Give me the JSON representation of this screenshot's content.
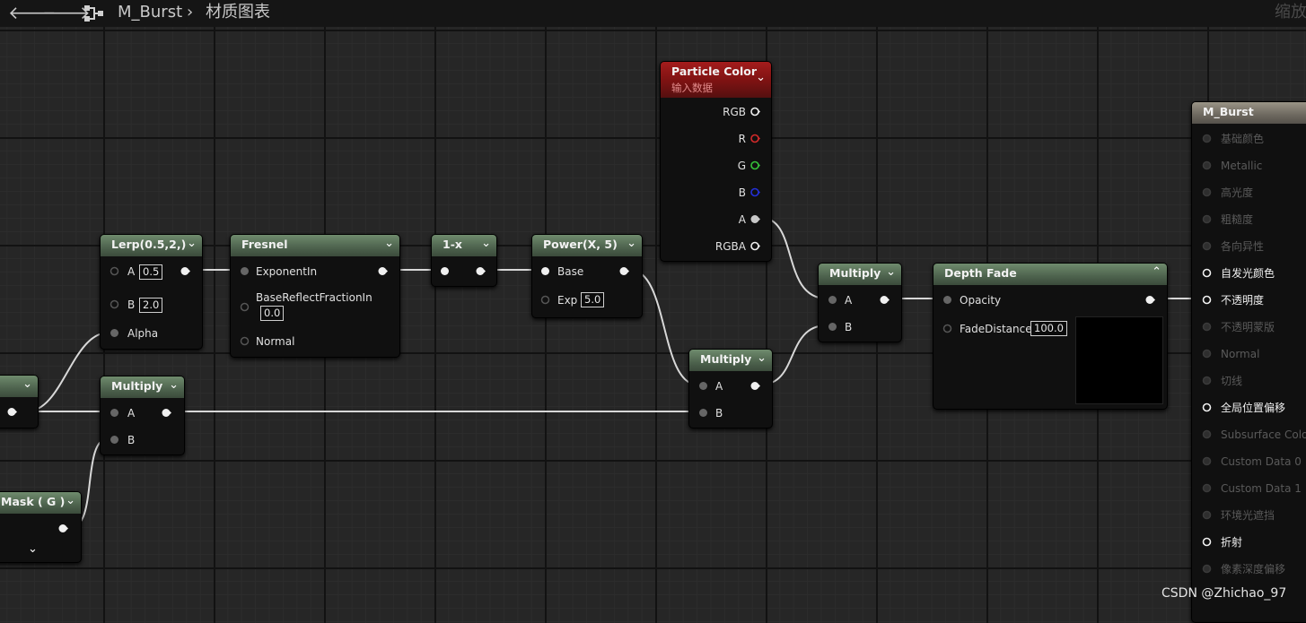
{
  "breadcrumb": {
    "asset": "M_Burst",
    "separator": "›",
    "graph": "材质图表",
    "zoom_label": "缩放"
  },
  "nav": {
    "back_icon": "arrow-left-icon",
    "forward_icon": "arrow-right-icon",
    "graph_icon": "node-graph-icon"
  },
  "nodes": {
    "lerp": {
      "title": "Lerp(0.5,2,)",
      "pin_a": "A",
      "a_value": "0.5",
      "pin_b": "B",
      "b_value": "2.0",
      "pin_alpha": "Alpha"
    },
    "fresnel": {
      "title": "Fresnel",
      "pin_exponent": "ExponentIn",
      "pin_base_reflect": "BaseReflectFractionIn",
      "base_reflect_value": "0.0",
      "pin_normal": "Normal"
    },
    "one_minus": {
      "title": "1-x"
    },
    "power": {
      "title": "Power(X, 5)",
      "pin_base": "Base",
      "pin_exp": "Exp",
      "exp_value": "5.0"
    },
    "particle_color": {
      "title": "Particle Color",
      "subtitle": "输入数据",
      "pins": [
        "RGB",
        "R",
        "G",
        "B",
        "A",
        "RGBA"
      ]
    },
    "multiply_left": {
      "title": "Multiply",
      "pin_a": "A",
      "pin_b": "B"
    },
    "multiply_middle": {
      "title": "Multiply",
      "pin_a": "A",
      "pin_b": "B"
    },
    "multiply_right": {
      "title": "Multiply",
      "pin_a": "A",
      "pin_b": "B"
    },
    "depth_fade": {
      "title": "Depth Fade",
      "pin_opacity": "Opacity",
      "pin_fade_distance": "FadeDistance",
      "fade_distance_value": "100.0"
    },
    "mask": {
      "title": "Mask ( G )"
    },
    "output": {
      "title": "M_Burst",
      "pins": [
        "基础颜色",
        "Metallic",
        "高光度",
        "粗糙度",
        "各向异性",
        "自发光颜色",
        "不透明度",
        "不透明蒙版",
        "Normal",
        "切线",
        "全局位置偏移",
        "Subsurface Color",
        "Custom Data 0",
        "Custom Data 1",
        "环境光遮挡",
        "折射",
        "像素深度偏移"
      ],
      "active": [
        false,
        false,
        false,
        false,
        false,
        true,
        true,
        false,
        false,
        false,
        true,
        false,
        false,
        false,
        false,
        true,
        false
      ]
    }
  },
  "colors": {
    "pin_red": "#d42a2a",
    "pin_green": "#36c23a",
    "pin_blue": "#2330d8",
    "wire": "#d8d8d8",
    "header_green": "#5e7a5d",
    "header_red": "#8e1818"
  },
  "watermark": "CSDN @Zhichao_97"
}
